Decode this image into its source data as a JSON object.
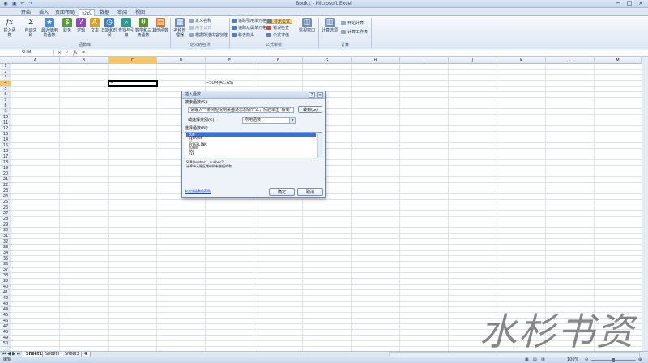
{
  "window": {
    "title": "Book1 - Microsoft Excel",
    "controls": [
      "−",
      "□",
      "×"
    ]
  },
  "tabs": [
    "开始",
    "插入",
    "页面布局",
    "公式",
    "数据",
    "审阅",
    "视图"
  ],
  "active_tab": "公式",
  "ribbon": {
    "function_library": {
      "buttons": [
        "插入函数",
        "自动求和",
        "最近使用的函数",
        "财务",
        "逻辑",
        "文本",
        "日期和时间",
        "查找与引用",
        "数学和三角函数",
        "其他函数"
      ],
      "label": "函数库"
    },
    "defined_names": {
      "name_manager": "名称管理器",
      "items": [
        "定义名称",
        "用于公式",
        "根据所选内容创建"
      ],
      "label": "定义的名称"
    },
    "formula_auditing": {
      "items": [
        "追踪引用单元格",
        "追踪从属单元格",
        "移去箭头",
        "显示公式",
        "错误检查",
        "公式求值"
      ],
      "watch_window": "监视窗口",
      "label": "公式审核"
    },
    "calculation": {
      "options": "计算选项",
      "items": [
        "开始计算",
        "计算工作表"
      ],
      "label": "计算"
    }
  },
  "formula_bar": {
    "name_box": "SUM",
    "icons": [
      "✕",
      "✓",
      "fx"
    ],
    "content": "="
  },
  "grid": {
    "columns": [
      "A",
      "B",
      "C",
      "D",
      "E",
      "F",
      "G",
      "H",
      "I",
      "J",
      "K",
      "L",
      "M"
    ],
    "selected_column": "C",
    "selected_row": "4",
    "active_cell_value": "=",
    "cell_formula_text": "=SUM(A1:A5)"
  },
  "dialog": {
    "title": "插入函数",
    "search_label": "搜索函数(S):",
    "search_value": "请输入一条简短说明来描述您想做什么，然后单击“转到”",
    "go_button": "转到(G)",
    "category_label": "或选择类别(C):",
    "category_value": "常用函数",
    "list_label": "选择函数(N):",
    "functions": [
      "SUM",
      "AVERAGE",
      "IF",
      "HYPERLINK",
      "COUNT",
      "MAX",
      "SIN"
    ],
    "selected_function": "SUM",
    "syntax": "SUM(number1,number2,...)",
    "description": "计算单元格区域中所有数值的和",
    "help_link": "有关该函数的帮助",
    "ok_button": "确定",
    "cancel_button": "取消",
    "help_icon": "?",
    "close_icon": "×"
  },
  "sheets": [
    "Sheet1",
    "Sheet2",
    "Sheet3"
  ],
  "active_sheet": "Sheet1",
  "status": {
    "left": "编辑",
    "zoom": "100%"
  },
  "watermark": "水杉书资"
}
